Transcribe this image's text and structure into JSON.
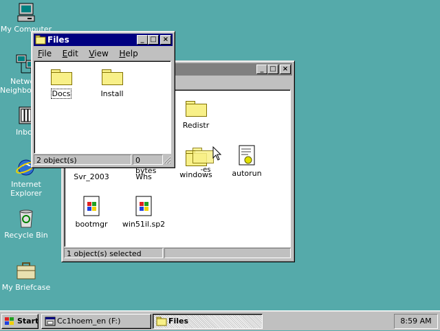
{
  "desktop": {
    "background_color": "#55aaaa",
    "icons": [
      {
        "label": "My Computer",
        "icon": "my-computer-icon"
      },
      {
        "label": "Network Neighborhood",
        "line1": "Network",
        "line2": "Neighborhood",
        "icon": "network-icon"
      },
      {
        "label": "Inbox",
        "icon": "inbox-icon"
      },
      {
        "label": "Internet Explorer",
        "line1": "Internet",
        "line2": "Explorer",
        "icon": "internet-explorer-icon"
      },
      {
        "label": "Recycle Bin",
        "icon": "recycle-bin-icon"
      },
      {
        "label": "My Briefcase",
        "icon": "briefcase-icon"
      }
    ]
  },
  "back_window": {
    "items": [
      {
        "label": "Redistr",
        "type": "folder"
      },
      {
        "label": "Svr_2003",
        "type": "folder"
      },
      {
        "label": "Whs",
        "type": "folder"
      },
      {
        "label": "windows",
        "type": "folder"
      },
      {
        "label": "-es",
        "type": "folder"
      },
      {
        "label": "autorun",
        "type": "file"
      },
      {
        "label": "bootmgr",
        "type": "file"
      },
      {
        "label": "win51il.sp2",
        "type": "file"
      }
    ],
    "status": "1 object(s) selected"
  },
  "front_window": {
    "title": "Files",
    "menu": [
      {
        "label": "File",
        "underline": "F",
        "rest": "ile"
      },
      {
        "label": "Edit",
        "underline": "E",
        "rest": "dit"
      },
      {
        "label": "View",
        "underline": "V",
        "rest": "iew"
      },
      {
        "label": "Help",
        "underline": "H",
        "rest": "elp"
      }
    ],
    "items": [
      {
        "label": "Docs",
        "type": "folder"
      },
      {
        "label": "Install",
        "type": "folder"
      }
    ],
    "status_count": "2 object(s)",
    "status_size": "0 bytes",
    "buttons": {
      "minimize": "_",
      "maximize": "□",
      "close": "×"
    }
  },
  "taskbar": {
    "start_label": "Start",
    "tasks": [
      {
        "label": "Cc1hoem_en (F:)"
      },
      {
        "label": "Files"
      }
    ],
    "clock": "8:59 AM"
  }
}
